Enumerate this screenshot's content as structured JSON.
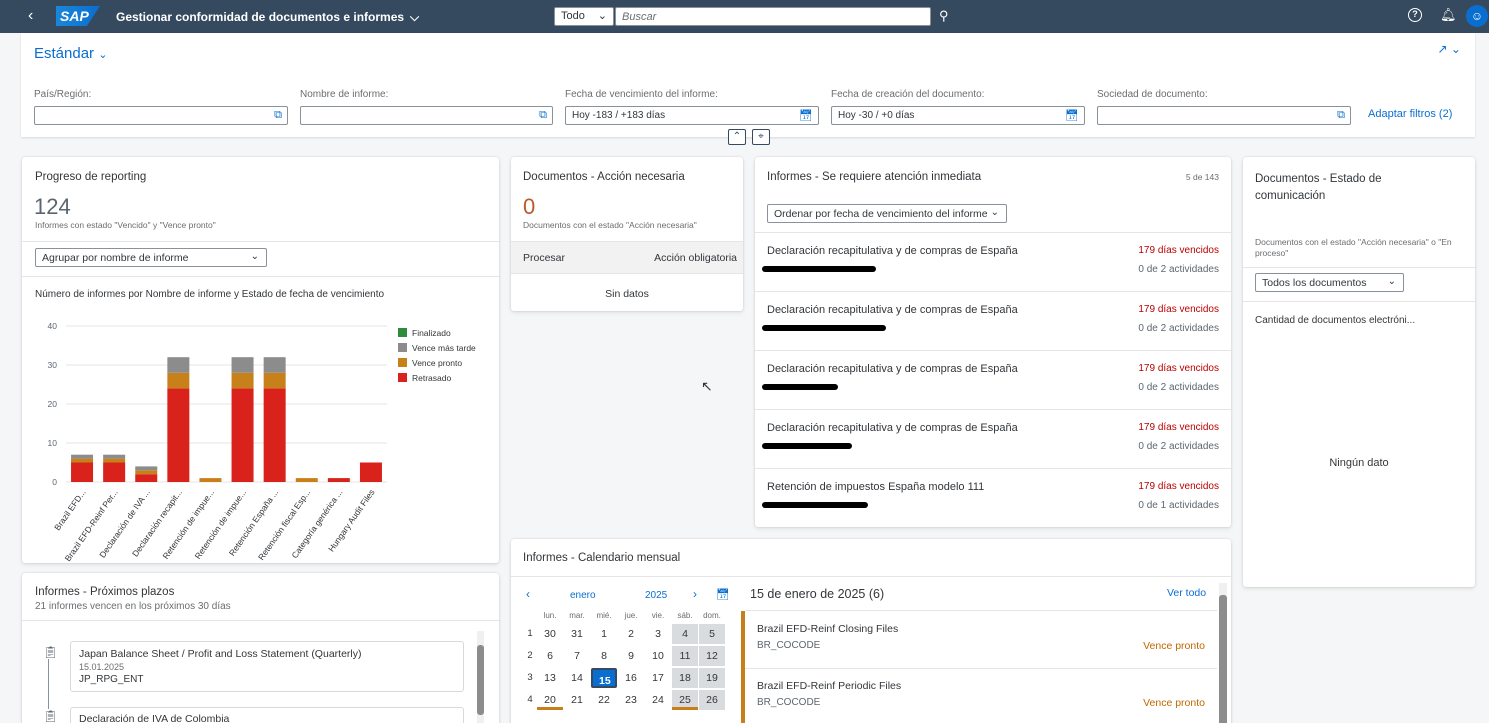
{
  "shell": {
    "logo": "SAP",
    "title": "Gestionar conformidad de documentos e informes",
    "scope": "Todo",
    "search_placeholder": "Buscar",
    "help": "?",
    "avatar": "8"
  },
  "header": {
    "variant": "Estándar",
    "adapt": "Adaptar filtros (2)",
    "filters": [
      {
        "label": "País/Región:",
        "value": ""
      },
      {
        "label": "Nombre de informe:",
        "value": ""
      },
      {
        "label": "Fecha de vencimiento del informe:",
        "value": "Hoy -183 / +183 días"
      },
      {
        "label": "Fecha de creación del documento:",
        "value": "Hoy -30 / +0 días"
      },
      {
        "label": "Sociedad de documento:",
        "value": ""
      }
    ]
  },
  "progress": {
    "title": "Progreso de reporting",
    "kpi": "124",
    "sub": "Informes con estado \"Vencido\" y \"Vence pronto\"",
    "group": "Agrupar por nombre de informe",
    "chart_title": "Número de informes por Nombre de informe y Estado de fecha de vencimiento"
  },
  "chart_data": {
    "type": "bar",
    "stacked": true,
    "ylim": [
      0,
      40
    ],
    "yticks": [
      0,
      10,
      20,
      30,
      40
    ],
    "categories": [
      "Brazil EFD...",
      "Brazil EFD-Reinf Per...",
      "Declaración de IVA ...",
      "Declaración recapit...",
      "Retención de impue...",
      "Retención de impue...",
      "Retención España ...",
      "Retención fiscal Esp...",
      "Categoría genérica ...",
      "Hungary Audit Files"
    ],
    "series": [
      {
        "name": "Finalizado",
        "color": "#2e8b3c",
        "values": [
          0,
          0,
          0,
          0,
          0,
          0,
          0,
          0,
          0,
          0
        ]
      },
      {
        "name": "Vence más tarde",
        "color": "#8c8c8c",
        "values": [
          1,
          1,
          1,
          4,
          0,
          4,
          4,
          0,
          0,
          0
        ]
      },
      {
        "name": "Vence pronto",
        "color": "#c8801a",
        "values": [
          1,
          1,
          1,
          4,
          1,
          4,
          4,
          1,
          0,
          0
        ]
      },
      {
        "name": "Retrasado",
        "color": "#d8221b",
        "values": [
          5,
          5,
          2,
          24,
          0,
          24,
          24,
          0,
          1,
          5
        ]
      }
    ],
    "legend": "right"
  },
  "docs_action": {
    "title": "Documentos - Acción necesaria",
    "kpi": "0",
    "sub": "Documentos con el estado \"Acción necesaria\"",
    "col1": "Procesar",
    "col2": "Acción obligatoria",
    "empty": "Sin datos"
  },
  "urgent": {
    "title": "Informes - Se requiere atención inmediata",
    "count": "5 de 143",
    "sort": "Ordenar por fecha de vencimiento del informe",
    "items": [
      {
        "name": "Declaración recapitulativa y de compras de España",
        "status": "179 días vencidos",
        "acts": "0 de 2 actividades"
      },
      {
        "name": "Declaración recapitulativa y de compras de España",
        "status": "179 días vencidos",
        "acts": "0 de 2 actividades"
      },
      {
        "name": "Declaración recapitulativa y de compras de España",
        "status": "179 días vencidos",
        "acts": "0 de 2 actividades"
      },
      {
        "name": "Declaración recapitulativa y de compras de España",
        "status": "179 días vencidos",
        "acts": "0 de 2 actividades"
      },
      {
        "name": "Retención de impuestos España modelo 111",
        "status": "179 días vencidos",
        "acts": "0 de 1 actividades"
      }
    ]
  },
  "comm": {
    "title": "Documentos - Estado de comunicación",
    "sub": "Documentos con el estado \"Acción necesaria\" o \"En proceso\"",
    "filter": "Todos los documentos",
    "chart_title": "Cantidad de documentos electróni...",
    "empty": "Ningún dato"
  },
  "deadlines": {
    "title": "Informes - Próximos plazos",
    "sub": "21 informes vencen en los próximos 30 días",
    "items": [
      {
        "name": "Japan Balance Sheet / Profit and Loss Statement (Quarterly)",
        "date": "15.01.2025",
        "code": "JP_RPG_ENT"
      },
      {
        "name": "Declaración de IVA de Colombia"
      }
    ]
  },
  "calendar": {
    "title": "Informes - Calendario mensual",
    "month": "enero",
    "year": "2025",
    "selected_title": "15 de enero de 2025 (6)",
    "see_all": "Ver todo",
    "weekdays": [
      "lun.",
      "mar.",
      "mié.",
      "jue.",
      "vie.",
      "sáb.",
      "dom."
    ],
    "weeks": [
      {
        "n": "1",
        "d": [
          "30",
          "31",
          "1",
          "2",
          "3",
          "4",
          "5"
        ]
      },
      {
        "n": "2",
        "d": [
          "6",
          "7",
          "8",
          "9",
          "10",
          "11",
          "12"
        ]
      },
      {
        "n": "3",
        "d": [
          "13",
          "14",
          "15",
          "16",
          "17",
          "18",
          "19"
        ]
      },
      {
        "n": "4",
        "d": [
          "20",
          "21",
          "22",
          "23",
          "24",
          "25",
          "26"
        ]
      }
    ],
    "events": [
      {
        "name": "Brazil EFD-Reinf Closing Files",
        "code": "BR_COCODE",
        "status": "Vence pronto"
      },
      {
        "name": "Brazil EFD-Reinf Periodic Files",
        "code": "BR_COCODE",
        "status": "Vence pronto"
      }
    ]
  }
}
